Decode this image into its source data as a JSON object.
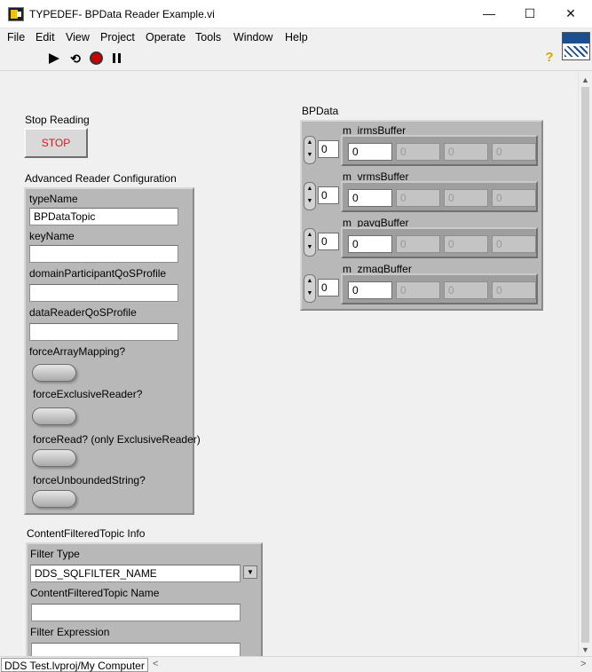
{
  "window": {
    "title": "TYPEDEF- BPData Reader Example.vi",
    "minimize": "—",
    "maximize": "☐",
    "close": "✕"
  },
  "menu": [
    "File",
    "Edit",
    "View",
    "Project",
    "Operate",
    "Tools",
    "Window",
    "Help"
  ],
  "toolbar": {
    "run_icon": "run-arrow-icon",
    "run_continuous_icon": "run-continuously-icon",
    "abort_icon": "abort-execution-icon",
    "pause_icon": "pause-icon",
    "help_glyph": "?",
    "continuous_glyph": "⟲"
  },
  "stop": {
    "label": "Stop Reading",
    "button": "STOP"
  },
  "advanced": {
    "label": "Advanced Reader Configuration",
    "typeName_label": "typeName",
    "typeName_value": "BPDataTopic",
    "keyName_label": "keyName",
    "keyName_value": "",
    "domainQoS_label": "domainParticipantQoSProfile",
    "domainQoS_value": "",
    "readerQoS_label": "dataReaderQoSProfile",
    "readerQoS_value": "",
    "forceArrayMapping_label": "forceArrayMapping?",
    "forceArrayMapping_value": false,
    "forceExclusiveReader_label": "forceExclusiveReader?",
    "forceExclusiveReader_value": false,
    "forceRead_label": "forceRead? (only ExclusiveReader)",
    "forceRead_value": false,
    "forceUnbounded_label": "forceUnboundedString?",
    "forceUnbounded_value": false
  },
  "cft": {
    "label": "ContentFilteredTopic Info",
    "filterType_label": "Filter Type",
    "filterType_value": "DDS_SQLFILTER_NAME",
    "topicName_label": "ContentFilteredTopic Name",
    "topicName_value": "",
    "expr_label": "Filter Expression",
    "expr_value": ""
  },
  "bpdata": {
    "label": "BPData",
    "arrays": [
      {
        "name": "m_irmsBuffer",
        "index": "0",
        "values": [
          "0",
          "0",
          "0",
          "0"
        ]
      },
      {
        "name": "m_vrmsBuffer",
        "index": "0",
        "values": [
          "0",
          "0",
          "0",
          "0"
        ]
      },
      {
        "name": "m_pavgBuffer",
        "index": "0",
        "values": [
          "0",
          "0",
          "0",
          "0"
        ]
      },
      {
        "name": "m_zmagBuffer",
        "index": "0",
        "values": [
          "0",
          "0",
          "0",
          "0"
        ]
      }
    ]
  },
  "status": {
    "context": "DDS Test.lvproj/My Computer"
  },
  "scroll": {
    "up": "▲",
    "down": "▼",
    "left": "<",
    "right": ">",
    "spin_up": "▲",
    "spin_down": "▼",
    "dropdown": "▼"
  }
}
